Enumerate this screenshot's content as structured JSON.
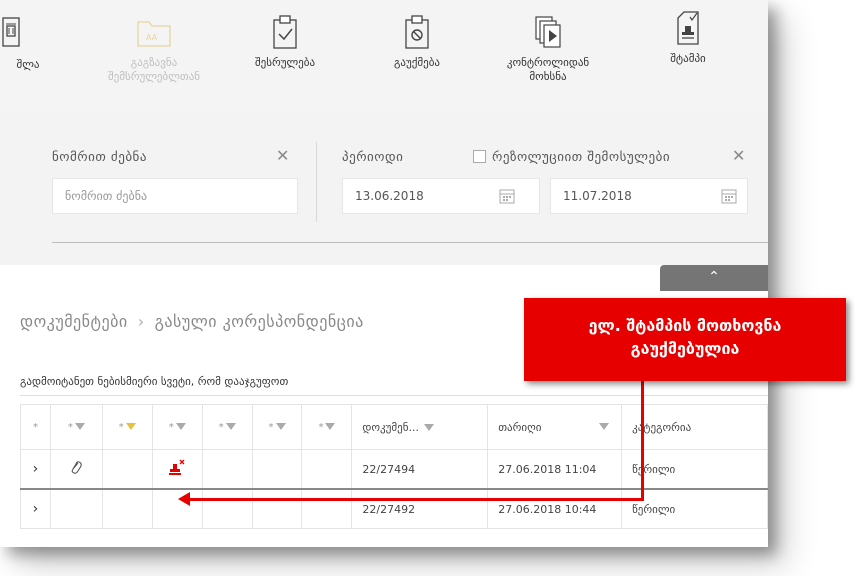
{
  "toolbar": {
    "buttons": [
      {
        "label": "შლა"
      },
      {
        "label": "გაგზავნა შემსრულებლთან",
        "line1": "გაგზავნა",
        "line2": "შემსრულებლთან"
      },
      {
        "label": "შესრულება"
      },
      {
        "label": "გაუქმება"
      },
      {
        "label": "კონტროლიდან მოხსნა",
        "line1": "კონტროლიდან",
        "line2": "მოხსნა"
      },
      {
        "label": "შტამპი"
      }
    ]
  },
  "filter": {
    "number_search_label": "ნომრით ძებნა",
    "number_search_placeholder": "ნომრით ძებნა",
    "clear_symbol": "✕",
    "period_label": "პერიოდი",
    "resolution_checkbox_label": "რეზოლუციით შემოსულები",
    "date_from": "13.06.2018",
    "date_to": "11.07.2018",
    "collapse_symbol": "⌃"
  },
  "breadcrumb": {
    "root": "დოკუმენტები",
    "separator": "›",
    "current": "გასული კორესპონდენცია"
  },
  "grid": {
    "group_hint": "გადმოიტანეთ ნებისმიერი სვეტი, რომ დააჯგუფოთ",
    "header_star": "*",
    "header_cols": [
      "დოკუმენ...",
      "თარიღი",
      "კატეგორია"
    ],
    "rows": [
      {
        "expand": "›",
        "number": "22/27494",
        "date": "27.06.2018 11:04",
        "category": "წერილი",
        "has_attachment": true,
        "has_cancelled_stamp": true
      },
      {
        "expand": "›",
        "number": "22/27492",
        "date": "27.06.2018 10:44",
        "category": "წერილი",
        "has_attachment": false,
        "has_cancelled_stamp": false
      }
    ]
  },
  "callout": {
    "line1": "ელ. შტამპის მოთხოვნა",
    "line2": "გაუქმებულია",
    "color": "#e60000"
  }
}
